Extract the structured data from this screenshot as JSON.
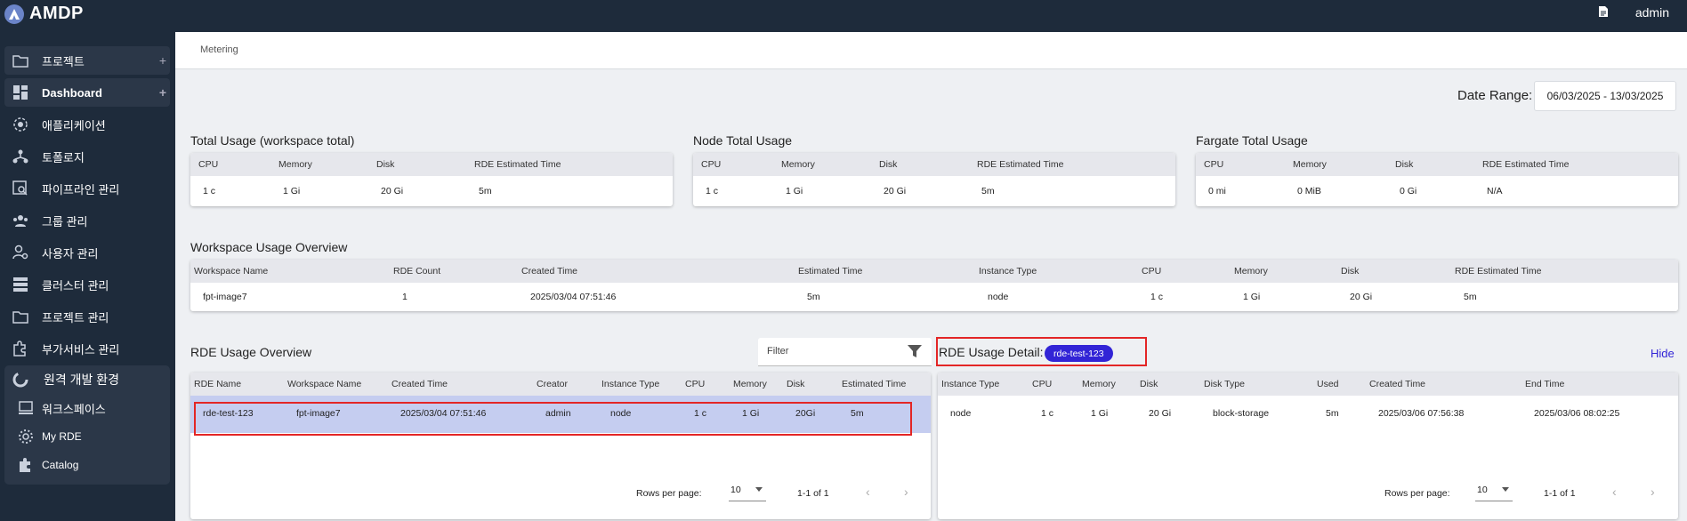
{
  "app": {
    "title": "AMDP",
    "user": "admin"
  },
  "sidebar": {
    "items": [
      {
        "label": "프로젝트",
        "icon": "folder-icon",
        "plus": "+"
      },
      {
        "label": "Dashboard",
        "icon": "dashboard-icon",
        "plus": "+"
      },
      {
        "label": "애플리케이션",
        "icon": "application-icon"
      },
      {
        "label": "토폴로지",
        "icon": "topology-icon"
      },
      {
        "label": "파이프라인 관리",
        "icon": "pipeline-icon"
      },
      {
        "label": "그룹 관리",
        "icon": "group-icon"
      },
      {
        "label": "사용자 관리",
        "icon": "user-settings-icon"
      },
      {
        "label": "클러스터 관리",
        "icon": "cluster-icon"
      },
      {
        "label": "프로젝트 관리",
        "icon": "folder-icon"
      },
      {
        "label": "부가서비스 관리",
        "icon": "extension-icon"
      }
    ],
    "group": {
      "title": "원격 개발 환경",
      "items": [
        {
          "label": "워크스페이스",
          "icon": "workspace-icon"
        },
        {
          "label": "My RDE",
          "icon": "gear-icon"
        },
        {
          "label": "Catalog",
          "icon": "puzzle-icon"
        }
      ]
    }
  },
  "breadcrumb": "Metering",
  "date_range": {
    "label": "Date Range:",
    "value": "06/03/2025 - 13/03/2025"
  },
  "usage_cards": [
    {
      "title": "Total Usage (workspace total)",
      "headers": [
        "CPU",
        "Memory",
        "Disk",
        "RDE Estimated Time"
      ],
      "values": [
        "1 c",
        "1 Gi",
        "20 Gi",
        "5m"
      ]
    },
    {
      "title": "Node Total Usage",
      "headers": [
        "CPU",
        "Memory",
        "Disk",
        "RDE Estimated Time"
      ],
      "values": [
        "1 c",
        "1 Gi",
        "20 Gi",
        "5m"
      ]
    },
    {
      "title": "Fargate Total Usage",
      "headers": [
        "CPU",
        "Memory",
        "Disk",
        "RDE Estimated Time"
      ],
      "values": [
        "0 mi",
        "0 MiB",
        "0 Gi",
        "N/A"
      ]
    }
  ],
  "workspace_overview": {
    "title": "Workspace Usage Overview",
    "headers": [
      "Workspace Name",
      "RDE Count",
      "Created Time",
      "Estimated Time",
      "Instance Type",
      "CPU",
      "Memory",
      "Disk",
      "RDE Estimated Time"
    ],
    "rows": [
      [
        "fpt-image7",
        "1",
        "2025/03/04 07:51:46",
        "5m",
        "node",
        "1 c",
        "1 Gi",
        "20 Gi",
        "5m"
      ]
    ]
  },
  "rde_overview": {
    "title": "RDE Usage Overview",
    "filter_label": "Filter",
    "headers": [
      "RDE Name",
      "Workspace Name",
      "Created Time",
      "Creator",
      "Instance Type",
      "CPU",
      "Memory",
      "Disk",
      "Estimated Time"
    ],
    "rows": [
      [
        "rde-test-123",
        "fpt-image7",
        "2025/03/04 07:51:46",
        "admin",
        "node",
        "1 c",
        "1 Gi",
        "20Gi",
        "5m"
      ]
    ],
    "rows_per_page_label": "Rows per page:",
    "rows_per_page": "10",
    "range": "1-1 of 1"
  },
  "rde_detail": {
    "title": "RDE Usage Detail:",
    "chip": "rde-test-123",
    "hide_label": "Hide",
    "headers": [
      "Instance Type",
      "CPU",
      "Memory",
      "Disk",
      "Disk Type",
      "Used",
      "Created Time",
      "End Time"
    ],
    "rows": [
      [
        "node",
        "1 c",
        "1 Gi",
        "20 Gi",
        "block-storage",
        "5m",
        "2025/03/06 07:56:38",
        "2025/03/06 08:02:25"
      ]
    ],
    "rows_per_page_label": "Rows per page:",
    "rows_per_page": "10",
    "range": "1-1 of 1"
  },
  "colors": {
    "sidebar_bg": "#1e2b3b",
    "accent": "#3224d6",
    "highlight_row": "#c5cdf0",
    "annotation_red": "#e32626"
  }
}
